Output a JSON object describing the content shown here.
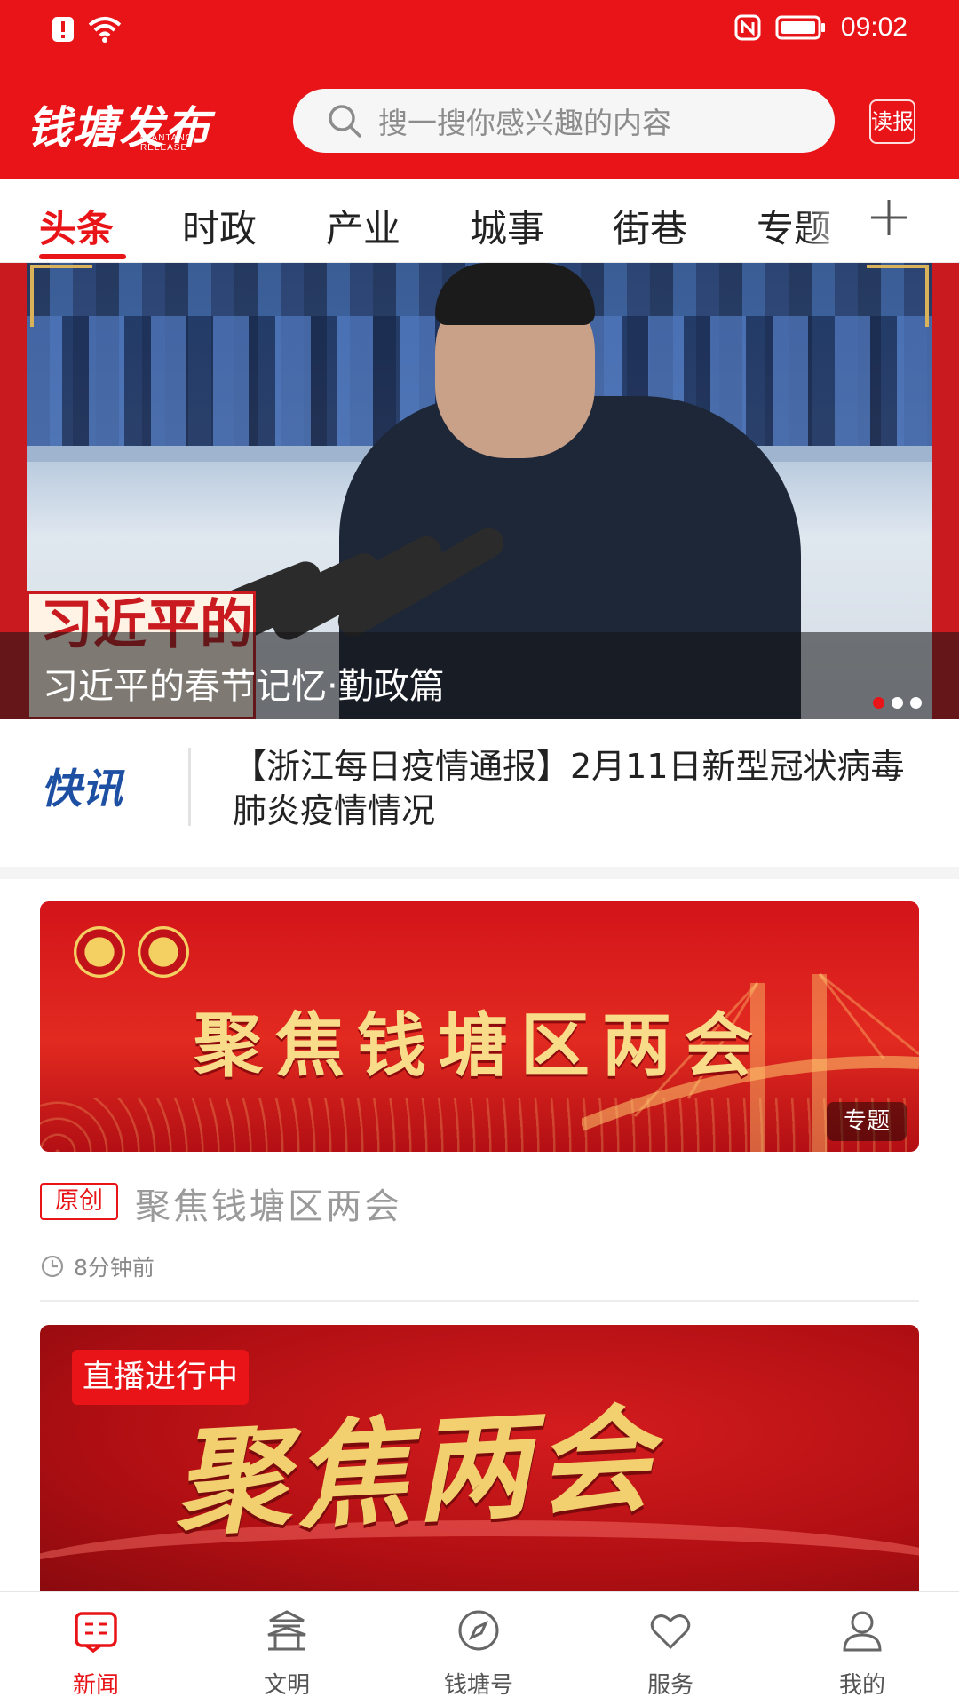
{
  "status_bar": {
    "time": "09:02"
  },
  "header": {
    "brand_name": "钱塘发布",
    "brand_sub": "QIANTANG RELEASE",
    "search_placeholder": "搜一搜你感兴趣的内容",
    "read_paper_label": "读报"
  },
  "tabs": [
    {
      "label": "头条",
      "active": true
    },
    {
      "label": "时政",
      "active": false
    },
    {
      "label": "产业",
      "active": false
    },
    {
      "label": "城事",
      "active": false
    },
    {
      "label": "街巷",
      "active": false
    },
    {
      "label": "专题",
      "active": false
    }
  ],
  "banner": {
    "caption": "习近平的春节记忆·勤政篇",
    "badge_text": "习近平的春节记忆",
    "slide_count": 3,
    "active_slide": 1
  },
  "flash_news": {
    "logo": "快讯",
    "text": "【浙江每日疫情通报】2月11日新型冠状病毒肺炎疫情情况"
  },
  "feed": [
    {
      "image_title": "聚焦钱塘区两会",
      "image_tag": "专题",
      "badge": "原创",
      "headline": "聚焦钱塘区两会",
      "time": "8分钟前"
    },
    {
      "live_badge": "直播进行中",
      "image_title": "聚焦两会"
    }
  ],
  "bottom_nav": [
    {
      "label": "新闻",
      "icon": "news-icon",
      "active": true
    },
    {
      "label": "文明",
      "icon": "pavilion-icon",
      "active": false
    },
    {
      "label": "钱塘号",
      "icon": "compass-icon",
      "active": false
    },
    {
      "label": "服务",
      "icon": "heart-icon",
      "active": false
    },
    {
      "label": "我的",
      "icon": "user-icon",
      "active": false
    }
  ],
  "colors": {
    "brand_red": "#e81418",
    "flash_blue": "#1d4fa3",
    "gold": "#f8dc8a"
  }
}
